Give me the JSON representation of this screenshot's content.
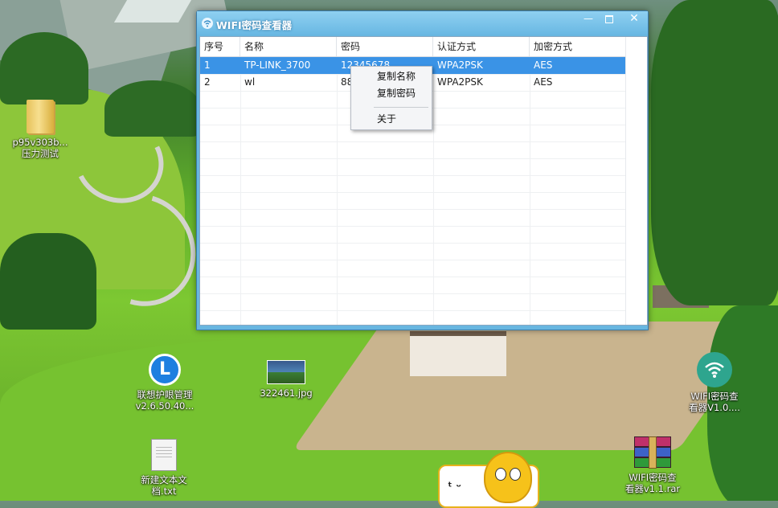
{
  "window": {
    "title": "WIFI密码查看器",
    "min_glyph": "—",
    "close_glyph": "✕"
  },
  "table": {
    "headers": [
      "序号",
      "名称",
      "密码",
      "认证方式",
      "加密方式"
    ],
    "rows": [
      [
        "1",
        "TP-LINK_3700",
        "12345678",
        "WPA2PSK",
        "AES"
      ],
      [
        "2",
        "wl",
        "88",
        "WPA2PSK",
        "AES"
      ]
    ],
    "selected_row": 0
  },
  "context_menu": {
    "items": [
      "复制名称",
      "复制密码",
      "关于"
    ]
  },
  "desktop_icons": {
    "folder": "p95v303b... 压力测试",
    "lenovo_line1": "联想护眼管理",
    "lenovo_line2": "v2.6.50.40...",
    "lenovo_glyph": "L",
    "jpg": "322461.jpg",
    "txt_line1": "新建文本文",
    "txt_line2": "档.txt",
    "wifi_app_line1": "WIFI密码查",
    "wifi_app_line2": "看器V1.0....",
    "rar_line1": "WIFI密码查",
    "rar_line2": "看器v1.1.rar"
  },
  "colors": {
    "title_bar": "#69b8e3",
    "selection": "#3a93e6",
    "desktop_grass": "#76c230"
  },
  "icons": [
    "wifi-icon",
    "minimize-icon",
    "maximize-icon",
    "close-icon"
  ]
}
